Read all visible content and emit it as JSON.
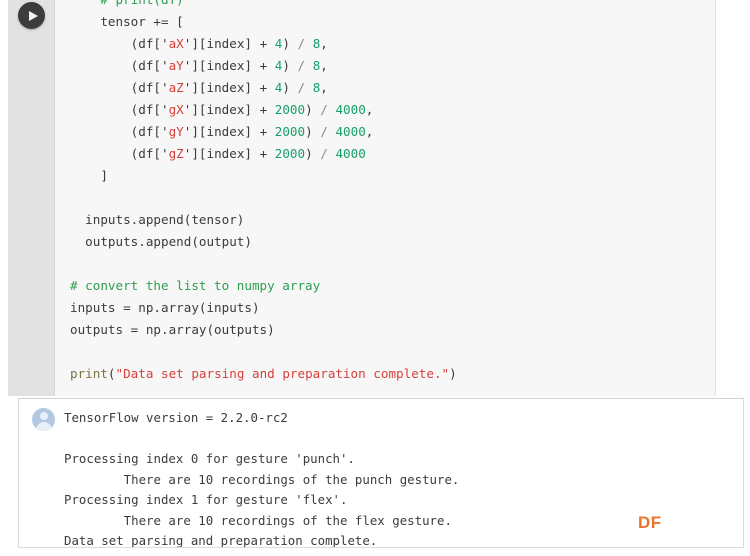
{
  "notebook": {
    "run_button_label": "run-cell",
    "code_cell": {
      "lines": [
        [
          {
            "t": "com",
            "s": "    # print(df)"
          }
        ],
        [
          {
            "t": "pln",
            "s": "    tensor += ["
          }
        ],
        [
          {
            "t": "pln",
            "s": "        (df['"
          },
          {
            "t": "str",
            "s": "aX"
          },
          {
            "t": "pln",
            "s": "'][index] + "
          },
          {
            "t": "num",
            "s": "4"
          },
          {
            "t": "pln",
            "s": ") "
          },
          {
            "t": "op",
            "s": "/"
          },
          {
            "t": "num",
            "s": " 8"
          },
          {
            "t": "pln",
            "s": ","
          }
        ],
        [
          {
            "t": "pln",
            "s": "        (df['"
          },
          {
            "t": "str",
            "s": "aY"
          },
          {
            "t": "pln",
            "s": "'][index] + "
          },
          {
            "t": "num",
            "s": "4"
          },
          {
            "t": "pln",
            "s": ") "
          },
          {
            "t": "op",
            "s": "/"
          },
          {
            "t": "num",
            "s": " 8"
          },
          {
            "t": "pln",
            "s": ","
          }
        ],
        [
          {
            "t": "pln",
            "s": "        (df['"
          },
          {
            "t": "str",
            "s": "aZ"
          },
          {
            "t": "pln",
            "s": "'][index] + "
          },
          {
            "t": "num",
            "s": "4"
          },
          {
            "t": "pln",
            "s": ") "
          },
          {
            "t": "op",
            "s": "/"
          },
          {
            "t": "num",
            "s": " 8"
          },
          {
            "t": "pln",
            "s": ","
          }
        ],
        [
          {
            "t": "pln",
            "s": "        (df['"
          },
          {
            "t": "str",
            "s": "gX"
          },
          {
            "t": "pln",
            "s": "'][index] + "
          },
          {
            "t": "num",
            "s": "2000"
          },
          {
            "t": "pln",
            "s": ") "
          },
          {
            "t": "op",
            "s": "/"
          },
          {
            "t": "num",
            "s": " 4000"
          },
          {
            "t": "pln",
            "s": ","
          }
        ],
        [
          {
            "t": "pln",
            "s": "        (df['"
          },
          {
            "t": "str",
            "s": "gY"
          },
          {
            "t": "pln",
            "s": "'][index] + "
          },
          {
            "t": "num",
            "s": "2000"
          },
          {
            "t": "pln",
            "s": ") "
          },
          {
            "t": "op",
            "s": "/"
          },
          {
            "t": "num",
            "s": " 4000"
          },
          {
            "t": "pln",
            "s": ","
          }
        ],
        [
          {
            "t": "pln",
            "s": "        (df['"
          },
          {
            "t": "str",
            "s": "gZ"
          },
          {
            "t": "pln",
            "s": "'][index] + "
          },
          {
            "t": "num",
            "s": "2000"
          },
          {
            "t": "pln",
            "s": ") "
          },
          {
            "t": "op",
            "s": "/"
          },
          {
            "t": "num",
            "s": " 4000"
          }
        ],
        [
          {
            "t": "pln",
            "s": "    ]"
          }
        ],
        [
          {
            "t": "pln",
            "s": ""
          }
        ],
        [
          {
            "t": "pln",
            "s": "  inputs.append(tensor)"
          }
        ],
        [
          {
            "t": "pln",
            "s": "  outputs.append(output)"
          }
        ],
        [
          {
            "t": "pln",
            "s": ""
          }
        ],
        [
          {
            "t": "com",
            "s": "# convert the list to numpy array"
          }
        ],
        [
          {
            "t": "pln",
            "s": "inputs = np.array(inputs)"
          }
        ],
        [
          {
            "t": "pln",
            "s": "outputs = np.array(outputs)"
          }
        ],
        [
          {
            "t": "pln",
            "s": ""
          }
        ],
        [
          {
            "t": "fn",
            "s": "print"
          },
          {
            "t": "pln",
            "s": "("
          },
          {
            "t": "str",
            "s": "\"Data set parsing and preparation complete.\""
          },
          {
            "t": "pln",
            "s": ")"
          }
        ]
      ]
    },
    "output": {
      "avatar_label": "user-avatar",
      "lines": [
        "TensorFlow version = 2.2.0-rc2",
        "",
        "Processing index 0 for gesture 'punch'.",
        "        There are 10 recordings of the punch gesture.",
        "Processing index 1 for gesture 'flex'.",
        "        There are 10 recordings of the flex gesture.",
        "Data set parsing and preparation complete."
      ]
    },
    "watermark": "DF",
    "colors": {
      "comment": "#2e9e4f",
      "string": "#d6403b",
      "number": "#17a06b",
      "plain": "#3b3b3b",
      "function": "#7d7342",
      "watermark": "#e8752b",
      "cell_bg": "#f7f7f7",
      "gutter_bg": "#e2e2e2",
      "output_bg": "#ffffff"
    }
  }
}
